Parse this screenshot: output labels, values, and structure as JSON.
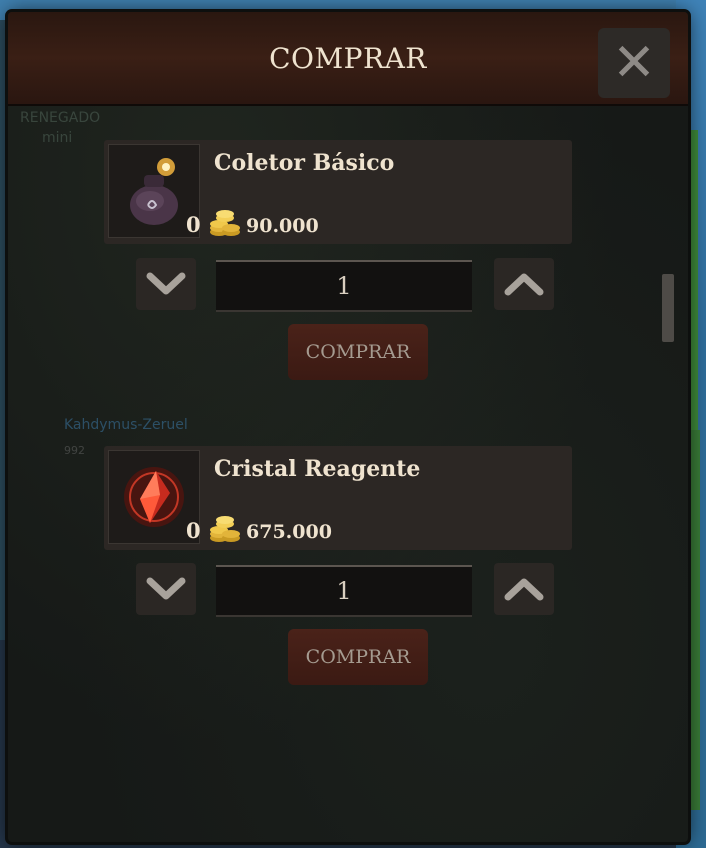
{
  "dialog": {
    "title": "COMPRAR",
    "close_icon": "close-icon"
  },
  "background": {
    "label_top": "RENEGADO",
    "label_top2": "mini",
    "player_name": "Kahdymus-Zeruel",
    "player_tag": "992"
  },
  "items": [
    {
      "name": "Coletor Básico",
      "owned": "0",
      "price": "90.000",
      "quantity": "1",
      "buy_label": "COMPRAR",
      "icon": "pouch-icon"
    },
    {
      "name": "Cristal Reagente",
      "owned": "0",
      "price": "675.000",
      "quantity": "1",
      "buy_label": "COMPRAR",
      "icon": "red-crystal-icon"
    }
  ],
  "colors": {
    "text": "#efe3cf",
    "button_red": "#4a2219",
    "panel": "#161917"
  }
}
